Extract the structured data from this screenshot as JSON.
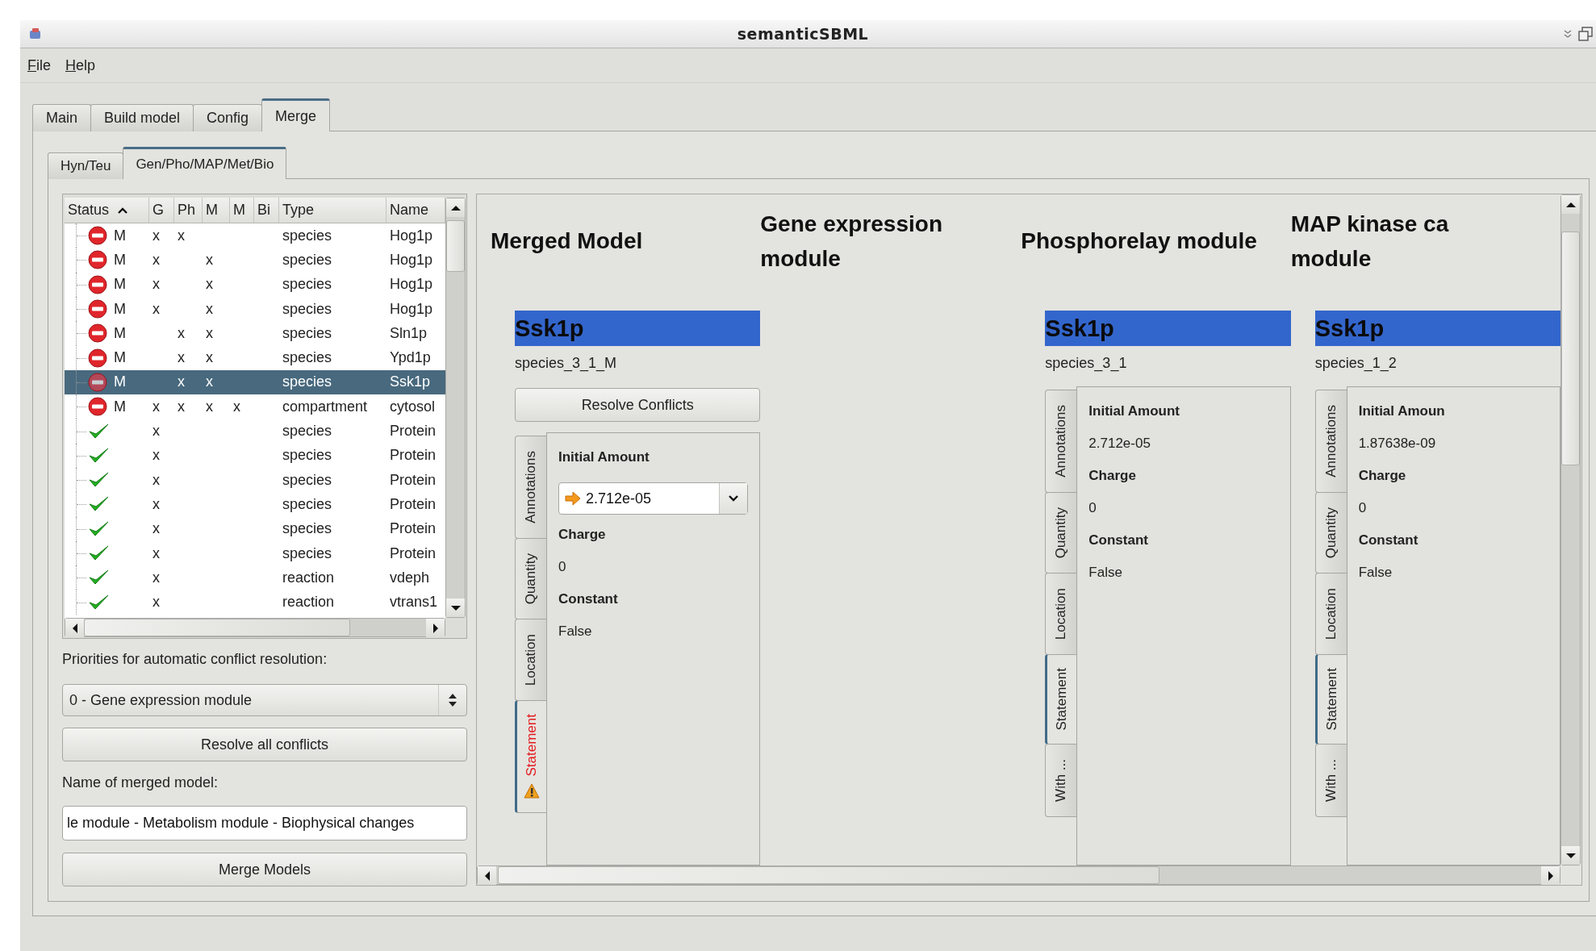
{
  "window": {
    "title": "semanticSBML"
  },
  "menu": [
    {
      "label": "File"
    },
    {
      "label": "Help"
    }
  ],
  "tabs": [
    {
      "label": "Main",
      "selected": false
    },
    {
      "label": "Build model",
      "selected": false
    },
    {
      "label": "Config",
      "selected": false
    },
    {
      "label": "Merge",
      "selected": true
    }
  ],
  "subtabs": [
    {
      "label": "Hyn/Teu",
      "selected": false
    },
    {
      "label": "Gen/Pho/MAP/Met/Bio",
      "selected": true
    }
  ],
  "table": {
    "columns": [
      {
        "label": "Status",
        "sorted": true
      },
      {
        "label": "G"
      },
      {
        "label": "Ph"
      },
      {
        "label": "M"
      },
      {
        "label": "M"
      },
      {
        "label": "Bi"
      },
      {
        "label": "Type"
      },
      {
        "label": "Name"
      }
    ],
    "rows": [
      {
        "conflict": true,
        "selected": false,
        "model": "M",
        "g": "x",
        "ph": "x",
        "type": "species",
        "name": "Hog1p"
      },
      {
        "conflict": true,
        "selected": false,
        "model": "M",
        "g": "x",
        "ma": "x",
        "type": "species",
        "name": "Hog1p"
      },
      {
        "conflict": true,
        "selected": false,
        "model": "M",
        "g": "x",
        "ma": "x",
        "type": "species",
        "name": "Hog1p"
      },
      {
        "conflict": true,
        "selected": false,
        "model": "M",
        "g": "x",
        "ma": "x",
        "type": "species",
        "name": "Hog1p"
      },
      {
        "conflict": true,
        "selected": false,
        "model": "M",
        "ph": "x",
        "ma": "x",
        "type": "species",
        "name": "Sln1p"
      },
      {
        "conflict": true,
        "selected": false,
        "model": "M",
        "ph": "x",
        "ma": "x",
        "type": "species",
        "name": "Ypd1p"
      },
      {
        "conflict": true,
        "selected": true,
        "model": "M",
        "ph": "x",
        "ma": "x",
        "type": "species",
        "name": "Ssk1p"
      },
      {
        "conflict": true,
        "selected": false,
        "model": "M",
        "g": "x",
        "ph": "x",
        "ma": "x",
        "m": "x",
        "type": "compartment",
        "name": "cytosol"
      },
      {
        "conflict": false,
        "selected": false,
        "g": "x",
        "type": "species",
        "name": "Protein"
      },
      {
        "conflict": false,
        "selected": false,
        "g": "x",
        "type": "species",
        "name": "Protein"
      },
      {
        "conflict": false,
        "selected": false,
        "g": "x",
        "type": "species",
        "name": "Protein"
      },
      {
        "conflict": false,
        "selected": false,
        "g": "x",
        "type": "species",
        "name": "Protein"
      },
      {
        "conflict": false,
        "selected": false,
        "g": "x",
        "type": "species",
        "name": "Protein"
      },
      {
        "conflict": false,
        "selected": false,
        "g": "x",
        "type": "species",
        "name": "Protein"
      },
      {
        "conflict": false,
        "selected": false,
        "g": "x",
        "type": "reaction",
        "name": "vdeph"
      },
      {
        "conflict": false,
        "selected": false,
        "g": "x",
        "type": "reaction",
        "name": "vtrans1"
      }
    ]
  },
  "controls": {
    "priority_label": "Priorities for automatic conflict resolution:",
    "priority": "0 - Gene expression module",
    "resolve_all": "Resolve all conflicts",
    "name_label": "Name of merged model:",
    "name_value": "le module - Metabolism module - Biophysical changes",
    "merge": "Merge Models"
  },
  "comparison": {
    "columns": [
      {
        "heading": [
          "Merged Model"
        ],
        "element": {
          "name": "Ssk1p",
          "identifier": "species_3_1_M",
          "button": "Resolve Conflicts",
          "tabs": [
            {
              "label": "Annotations",
              "selected": false,
              "conflict": false
            },
            {
              "label": "Quantity",
              "selected": false,
              "conflict": false
            },
            {
              "label": "Location",
              "selected": false,
              "conflict": false
            },
            {
              "label": "Statement",
              "selected": true,
              "conflict": true
            }
          ],
          "fields": [
            {
              "kind": "label",
              "text": "Initial Amount"
            },
            {
              "kind": "choice",
              "text": "2.712e-05"
            },
            {
              "kind": "label",
              "text": "Charge"
            },
            {
              "kind": "value",
              "text": "0"
            },
            {
              "kind": "label",
              "text": "Constant"
            },
            {
              "kind": "value",
              "text": "False"
            }
          ]
        }
      },
      {
        "heading": [
          "Gene expression",
          "module"
        ]
      },
      {
        "heading": [
          "Phosphorelay module"
        ],
        "element": {
          "name": "Ssk1p",
          "identifier": "species_3_1",
          "tabs": [
            {
              "label": "Annotations",
              "selected": false,
              "conflict": false
            },
            {
              "label": "Quantity",
              "selected": false,
              "conflict": false
            },
            {
              "label": "Location",
              "selected": false,
              "conflict": false
            },
            {
              "label": "Statement",
              "selected": true,
              "conflict": false
            },
            {
              "label": "With ...",
              "selected": false,
              "conflict": false
            }
          ],
          "fields": [
            {
              "kind": "label",
              "text": "Initial Amount"
            },
            {
              "kind": "value",
              "text": "2.712e-05"
            },
            {
              "kind": "label",
              "text": "Charge"
            },
            {
              "kind": "value",
              "text": "0"
            },
            {
              "kind": "label",
              "text": "Constant"
            },
            {
              "kind": "value",
              "text": "False"
            }
          ]
        }
      },
      {
        "heading": [
          "MAP kinase ca",
          "module"
        ],
        "element": {
          "name": "Ssk1p",
          "identifier": "species_1_2",
          "tabs": [
            {
              "label": "Annotations",
              "selected": false,
              "conflict": false
            },
            {
              "label": "Quantity",
              "selected": false,
              "conflict": false
            },
            {
              "label": "Location",
              "selected": false,
              "conflict": false
            },
            {
              "label": "Statement",
              "selected": true,
              "conflict": false
            },
            {
              "label": "With ...",
              "selected": false,
              "conflict": false
            }
          ],
          "fields": [
            {
              "kind": "label",
              "text": "Initial Amoun"
            },
            {
              "kind": "value",
              "text": "1.87638e-09"
            },
            {
              "kind": "label",
              "text": "Charge"
            },
            {
              "kind": "value",
              "text": "0"
            },
            {
              "kind": "label",
              "text": "Constant"
            },
            {
              "kind": "value",
              "text": "False"
            }
          ]
        }
      }
    ]
  }
}
